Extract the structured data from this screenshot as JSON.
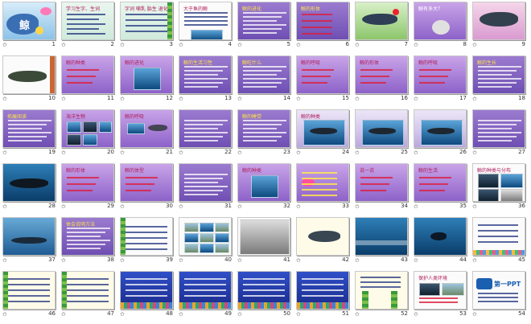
{
  "slides": [
    {
      "number": "1",
      "style": "whale-cover",
      "title": "鲸"
    },
    {
      "number": "2",
      "style": "green-text",
      "title": "学习生字、生词"
    },
    {
      "number": "3",
      "style": "mint-words",
      "title": "字词 哺乳 胎生 退化"
    },
    {
      "number": "4",
      "style": "white-text",
      "title": "大于鱼的鲸"
    },
    {
      "number": "5",
      "style": "violet-text",
      "title": "鲸的进化"
    },
    {
      "number": "6",
      "style": "violet-bullets",
      "title": "鲸的形体"
    },
    {
      "number": "7",
      "style": "green-whale",
      "title": ""
    },
    {
      "number": "8",
      "style": "violet-elephant",
      "title": "鲸有多大？"
    },
    {
      "number": "9",
      "style": "pink-whale",
      "title": ""
    },
    {
      "number": "10",
      "style": "white-whale",
      "title": ""
    },
    {
      "number": "11",
      "style": "violet-list",
      "title": "鲸的种类"
    },
    {
      "number": "12",
      "style": "violet-photo",
      "title": "鲸的进化"
    },
    {
      "number": "13",
      "style": "violet-text",
      "title": "鲸的生活习性"
    },
    {
      "number": "14",
      "style": "violet-text",
      "title": "鲸吃什么"
    },
    {
      "number": "15",
      "style": "violet-list",
      "title": "鲸的呼吸"
    },
    {
      "number": "16",
      "style": "violet-list",
      "title": "鲸的形体"
    },
    {
      "number": "17",
      "style": "violet-list",
      "title": "鲸的呼吸"
    },
    {
      "number": "18",
      "style": "violet-text",
      "title": "鲸的生长"
    },
    {
      "number": "19",
      "style": "violet-text",
      "title": "拓展阅读"
    },
    {
      "number": "20",
      "style": "violet-photos",
      "title": "海洋生物"
    },
    {
      "number": "21",
      "style": "violet-fish",
      "title": "鲸的呼吸"
    },
    {
      "number": "22",
      "style": "violet-text",
      "title": ""
    },
    {
      "number": "23",
      "style": "violet-text",
      "title": "鲸的睡觉"
    },
    {
      "number": "24",
      "style": "lavender-photo",
      "title": "鲸的种类"
    },
    {
      "number": "25",
      "style": "lavender-photo",
      "title": ""
    },
    {
      "number": "26",
      "style": "lavender-photo",
      "title": ""
    },
    {
      "number": "27",
      "style": "violet-text",
      "title": ""
    },
    {
      "number": "28",
      "style": "dark-photo",
      "title": ""
    },
    {
      "number": "29",
      "style": "violet-list",
      "title": "鲸的形体"
    },
    {
      "number": "30",
      "style": "violet-list",
      "title": "鲸的体型"
    },
    {
      "number": "31",
      "style": "violet-text",
      "title": ""
    },
    {
      "number": "32",
      "style": "violet-photo",
      "title": "鲸的种类"
    },
    {
      "number": "33",
      "style": "violet-mindmap",
      "title": ""
    },
    {
      "number": "34",
      "style": "violet-list",
      "title": "说一说"
    },
    {
      "number": "35",
      "style": "violet-list",
      "title": "鲸的生活"
    },
    {
      "number": "36",
      "style": "white-photos",
      "title": "鲸的种类与分布"
    },
    {
      "number": "37",
      "style": "sea-photo",
      "title": ""
    },
    {
      "number": "38",
      "style": "violet-text",
      "title": "体会说明方法"
    },
    {
      "number": "39",
      "style": "white-leaf",
      "title": ""
    },
    {
      "number": "40",
      "style": "white-grid",
      "title": ""
    },
    {
      "number": "41",
      "style": "photo-building",
      "title": ""
    },
    {
      "number": "42",
      "style": "white-whale2",
      "title": ""
    },
    {
      "number": "43",
      "style": "ocean-photo",
      "title": ""
    },
    {
      "number": "44",
      "style": "ocean-photo2",
      "title": ""
    },
    {
      "number": "45",
      "style": "white-kids",
      "title": ""
    },
    {
      "number": "46",
      "style": "cream-text",
      "title": ""
    },
    {
      "number": "47",
      "style": "cream-text",
      "title": ""
    },
    {
      "number": "48",
      "style": "blue-fringe",
      "title": ""
    },
    {
      "number": "49",
      "style": "blue-fringe",
      "title": ""
    },
    {
      "number": "50",
      "style": "blue-fringe",
      "title": ""
    },
    {
      "number": "51",
      "style": "blue-fringe",
      "title": ""
    },
    {
      "number": "52",
      "style": "cream-plant",
      "title": ""
    },
    {
      "number": "53",
      "style": "white-photos2",
      "title": "保护人类环境"
    },
    {
      "number": "54",
      "style": "ppt-logo",
      "title": "第一PPT"
    }
  ],
  "colors": {
    "selected_outline": "#f2b705",
    "page_bg": "#ffffff"
  }
}
